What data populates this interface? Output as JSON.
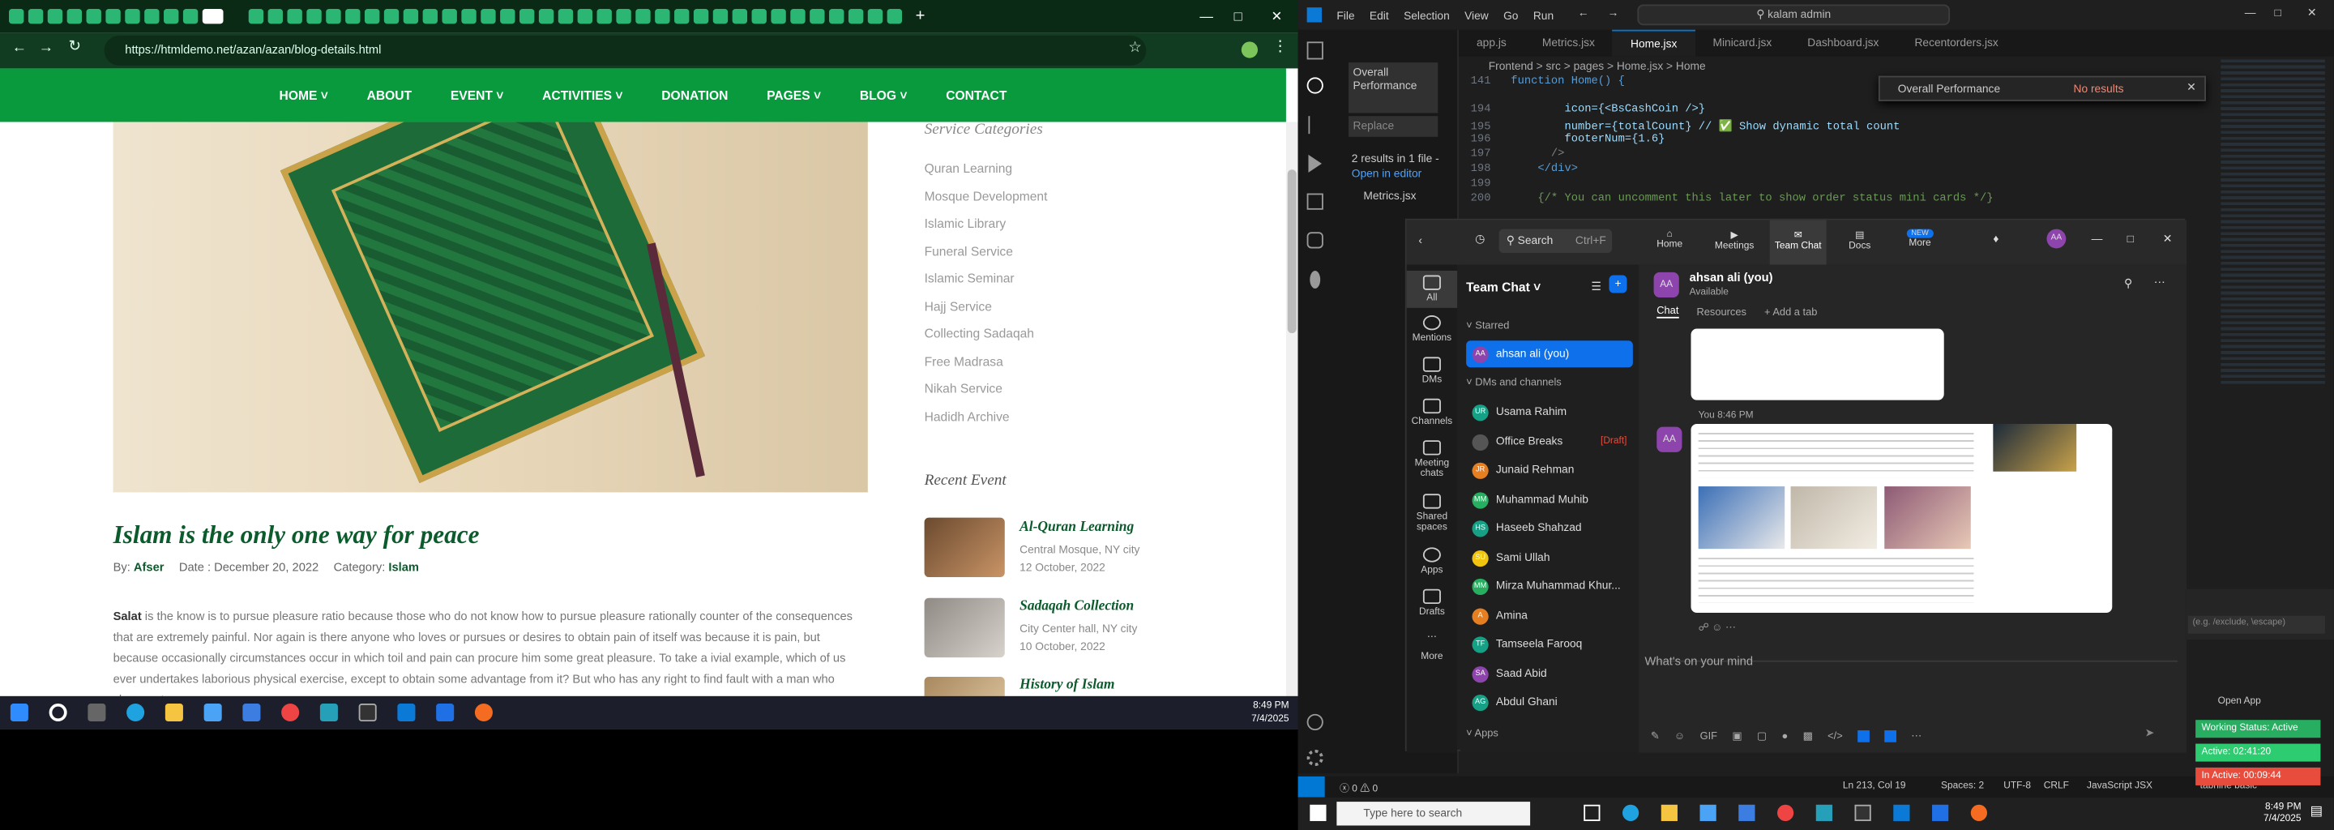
{
  "browser": {
    "url": "https://htmldemo.net/azan/azan/blog-details.html",
    "nav": [
      "HOME",
      "ABOUT",
      "EVENT",
      "ACTIVITIES",
      "DONATION",
      "PAGES",
      "BLOG",
      "CONTACT"
    ],
    "post": {
      "title": "Islam is the only one way for peace",
      "by_label": "By:",
      "author": "Afser",
      "date_label": "Date : December 20, 2022",
      "category_label": "Category:",
      "category": "Islam",
      "lead": "Salat",
      "body": " is the know is to pursue pleasure ratio because those who do not know how to pursue pleasure rationally counter of the consequences that are extremely painful. Nor again is there anyone who loves or pursues or desires to obtain pain of itself was because it is pain, but because occasionally circumstances occur in which toil and pain can procure him some great pleasure. To take a ivial example, which of us ever undertakes laborious physical exercise, except to obtain some advantage from it? But who has any right to find fault with a man who chooses to"
    },
    "sidebar": {
      "service_heading": "Service Categories",
      "categories": [
        "Quran Learning",
        "Mosque Development",
        "Islamic Library",
        "Funeral Service",
        "Islamic Seminar",
        "Hajj Service",
        "Collecting Sadaqah",
        "Free Madrasa",
        "Nikah Service",
        "Hadidh Archive"
      ],
      "event_heading": "Recent Event",
      "events": [
        {
          "title": "Al-Quran Learning",
          "place": "Central Mosque, NY city",
          "date": "12 October, 2022"
        },
        {
          "title": "Sadaqah Collection",
          "place": "City Center hall, NY city",
          "date": "10 October, 2022"
        },
        {
          "title": "History of Islam",
          "place": "",
          "date": ""
        }
      ]
    },
    "taskbar_time": "8:49 PM",
    "taskbar_date": "7/4/2025"
  },
  "vscode": {
    "menu": [
      "File",
      "Edit",
      "Selection",
      "View",
      "Go",
      "Run"
    ],
    "search_title": "kalam admin",
    "tabs": [
      "app.js",
      "Metrics.jsx",
      "Home.jsx",
      "Minicard.jsx",
      "Dashboard.jsx",
      "Recentorders.jsx"
    ],
    "breadcrumb": "Frontend > src > pages > Home.jsx > Home",
    "side_search": "Overall Performance",
    "replace_placeholder": "Replace",
    "results": "2 results in 1 file -",
    "open_in_editor": "Open in editor",
    "result_file": "Metrics.jsx",
    "find_text": "Overall Performance",
    "find_status": "No results",
    "code_lines": [
      {
        "n": "141",
        "t": "function Home() {"
      },
      {
        "n": "194",
        "t": "        icon={<BsCashCoin />}"
      },
      {
        "n": "195",
        "t": "        number={totalCount} // ✅ Show dynamic total count"
      },
      {
        "n": "196",
        "t": "        footerNum={1.6}"
      },
      {
        "n": "197",
        "t": "      />"
      },
      {
        "n": "198",
        "t": "    </div>"
      },
      {
        "n": "199",
        "t": ""
      },
      {
        "n": "200",
        "t": "    {/* You can uncomment this later to show order status mini cards */}"
      }
    ],
    "status": {
      "position": "Ln 213, Col 19",
      "spaces": "Spaces: 2",
      "enc": "UTF-8",
      "eol": "CRLF",
      "lang": "JavaScript JSX",
      "ext": "tabnine basic"
    }
  },
  "teams": {
    "search": "Search",
    "shortcut": "Ctrl+F",
    "top_nav": [
      "Home",
      "Meetings",
      "Team Chat",
      "Docs",
      "More"
    ],
    "new_badge": "NEW",
    "rail": [
      "All",
      "Mentions",
      "DMs",
      "Channels",
      "Meeting chats",
      "Shared spaces",
      "Apps",
      "Drafts",
      "More"
    ],
    "list_title": "Team Chat",
    "starred": "Starred",
    "self": "ahsan ali (you)",
    "dm_heading": "DMs and channels",
    "contacts": [
      {
        "name": "Usama Rahim",
        "i": "UR"
      },
      {
        "name": "Office Breaks",
        "i": "",
        "draft": "[Draft]"
      },
      {
        "name": "Junaid Rehman",
        "i": "JR"
      },
      {
        "name": "Muhammad Muhib",
        "i": "MM"
      },
      {
        "name": "Haseeb Shahzad",
        "i": "HS"
      },
      {
        "name": "Sami Ullah",
        "i": "SU"
      },
      {
        "name": "Mirza Muhammad Khur...",
        "i": "MM"
      },
      {
        "name": "Amina",
        "i": "A"
      },
      {
        "name": "Tamseela Farooq",
        "i": "TF"
      },
      {
        "name": "Saad Abid",
        "i": "SA"
      },
      {
        "name": "Abdul Ghani",
        "i": "AG"
      }
    ],
    "apps_label": "Apps",
    "header_name": "ahsan ali (you)",
    "status": "Available",
    "tabs": [
      "Chat",
      "Resources",
      "+ Add a tab"
    ],
    "message_time": "You 8:46 PM",
    "compose": "What's on your mind"
  },
  "right": {
    "exclude": "(e.g. /exclude, \\escape)",
    "open_app": "Open App",
    "working": "Working Status: Active",
    "active": "Active: 02:41:20",
    "inactive": "In Active: 00:09:44"
  },
  "taskbar2": {
    "search": "Type here to search",
    "time": "8:49 PM",
    "date": "7/4/2025"
  }
}
